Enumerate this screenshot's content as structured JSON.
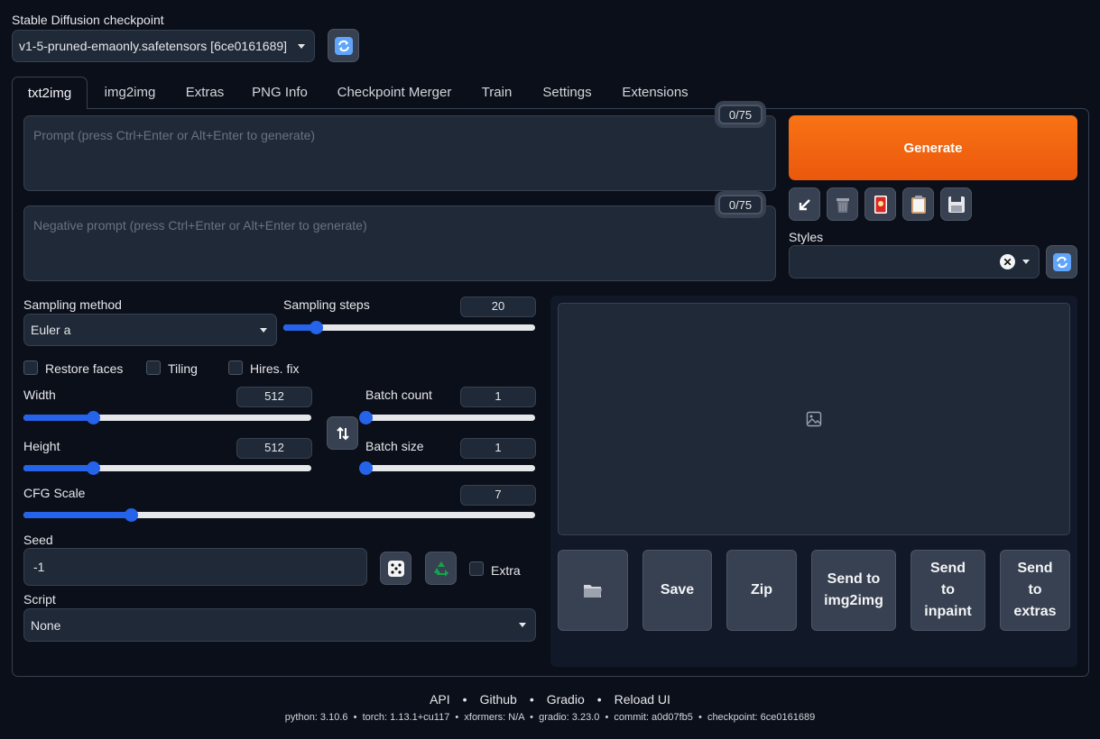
{
  "checkpoint": {
    "label": "Stable Diffusion checkpoint",
    "value": "v1-5-pruned-emaonly.safetensors [6ce0161689]"
  },
  "tabs": [
    "txt2img",
    "img2img",
    "Extras",
    "PNG Info",
    "Checkpoint Merger",
    "Train",
    "Settings",
    "Extensions"
  ],
  "prompt": {
    "placeholder": "Prompt (press Ctrl+Enter or Alt+Enter to generate)",
    "counter": "0/75"
  },
  "negative_prompt": {
    "placeholder": "Negative prompt (press Ctrl+Enter or Alt+Enter to generate)",
    "counter": "0/75"
  },
  "generate_label": "Generate",
  "styles_label": "Styles",
  "sampling": {
    "method_label": "Sampling method",
    "method_value": "Euler a",
    "steps_label": "Sampling steps",
    "steps_value": "20",
    "steps_fraction": 0.13
  },
  "checkboxes": {
    "restore_faces": "Restore faces",
    "tiling": "Tiling",
    "hires_fix": "Hires. fix",
    "extra": "Extra"
  },
  "width": {
    "label": "Width",
    "value": "512",
    "fraction": 0.24
  },
  "height": {
    "label": "Height",
    "value": "512",
    "fraction": 0.24
  },
  "batch_count": {
    "label": "Batch count",
    "value": "1",
    "fraction": 0
  },
  "batch_size": {
    "label": "Batch size",
    "value": "1",
    "fraction": 0
  },
  "cfg": {
    "label": "CFG Scale",
    "value": "7",
    "fraction": 0.21
  },
  "seed": {
    "label": "Seed",
    "value": "-1"
  },
  "script": {
    "label": "Script",
    "value": "None"
  },
  "output_buttons": {
    "save": "Save",
    "zip": "Zip",
    "send_img2img": "Send to img2img",
    "send_inpaint": "Send to inpaint",
    "send_extras": "Send to extras"
  },
  "footer": {
    "links": [
      "API",
      "Github",
      "Gradio",
      "Reload UI"
    ],
    "info": "python: 3.10.6  •  torch: 1.13.1+cu117  •  xformers: N/A  •  gradio: 3.23.0  •  commit: a0d07fb5  •  checkpoint: 6ce0161689"
  },
  "colors": {
    "accent": "#f97316",
    "slider": "#2563eb",
    "background": "#0b0f19"
  }
}
